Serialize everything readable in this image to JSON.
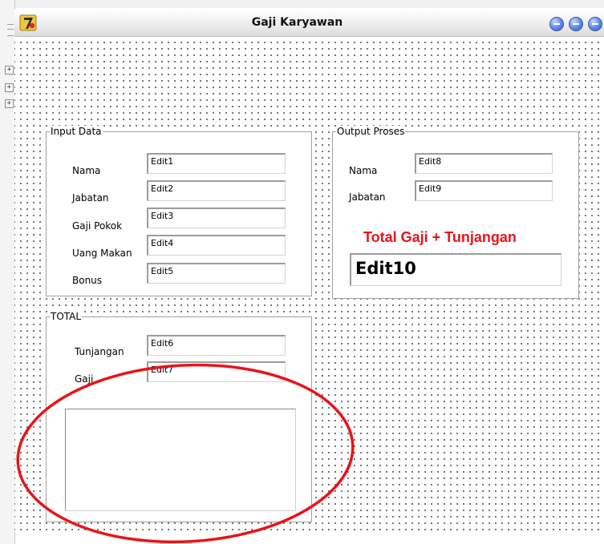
{
  "window": {
    "title": "Gaji Karyawan",
    "accent_color": "#e8141a",
    "title_button_color": "#3f6fe0"
  },
  "input_group": {
    "caption": "Input Data",
    "fields": [
      {
        "label": "Nama",
        "value": "Edit1"
      },
      {
        "label": "Jabatan",
        "value": "Edit2"
      },
      {
        "label": "Gaji Pokok",
        "value": "Edit3"
      },
      {
        "label": "Uang Makan",
        "value": "Edit4"
      },
      {
        "label": "Bonus",
        "value": "Edit5"
      }
    ]
  },
  "output_group": {
    "caption": "Output Proses",
    "fields": [
      {
        "label": "Nama",
        "value": "Edit8"
      },
      {
        "label": "Jabatan",
        "value": "Edit9"
      }
    ],
    "total_label": "Total Gaji + Tunjangan",
    "total_value": "Edit10"
  },
  "total_group": {
    "caption": "TOTAL",
    "fields": [
      {
        "label": "Tunjangan",
        "value": "Edit6"
      },
      {
        "label": "Gaji",
        "value": "Edit7"
      }
    ],
    "memo_value": ""
  },
  "icons": {
    "app": "delphi-app-icon",
    "minimize": "minimize-icon",
    "maximize": "maximize-icon",
    "close": "close-icon"
  }
}
